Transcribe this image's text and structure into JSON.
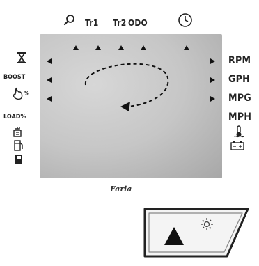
{
  "top_bar": {
    "labels": [
      "Tr1",
      "Tr2",
      "ODO"
    ],
    "icons": [
      "search-icon",
      "clock-icon"
    ]
  },
  "left_labels": {
    "boost": "BOOST",
    "percent": "%",
    "load": "LOAD%"
  },
  "right_labels": {
    "rpm": "RPM",
    "gph": "GPH",
    "mpg": "MPG",
    "mph": "MPH"
  },
  "left_icons": [
    "hourglass-icon",
    "hand-percent-icon",
    "oil-can-icon",
    "fuel-filter-icon",
    "fuel-pump-icon"
  ],
  "right_icons": [
    "temperature-icon",
    "battery-icon"
  ],
  "brand": "Faria",
  "button": {
    "icons": [
      "up-arrow-icon",
      "backlight-icon"
    ]
  },
  "display": {
    "indicator": "rotate-arrow-icon"
  }
}
